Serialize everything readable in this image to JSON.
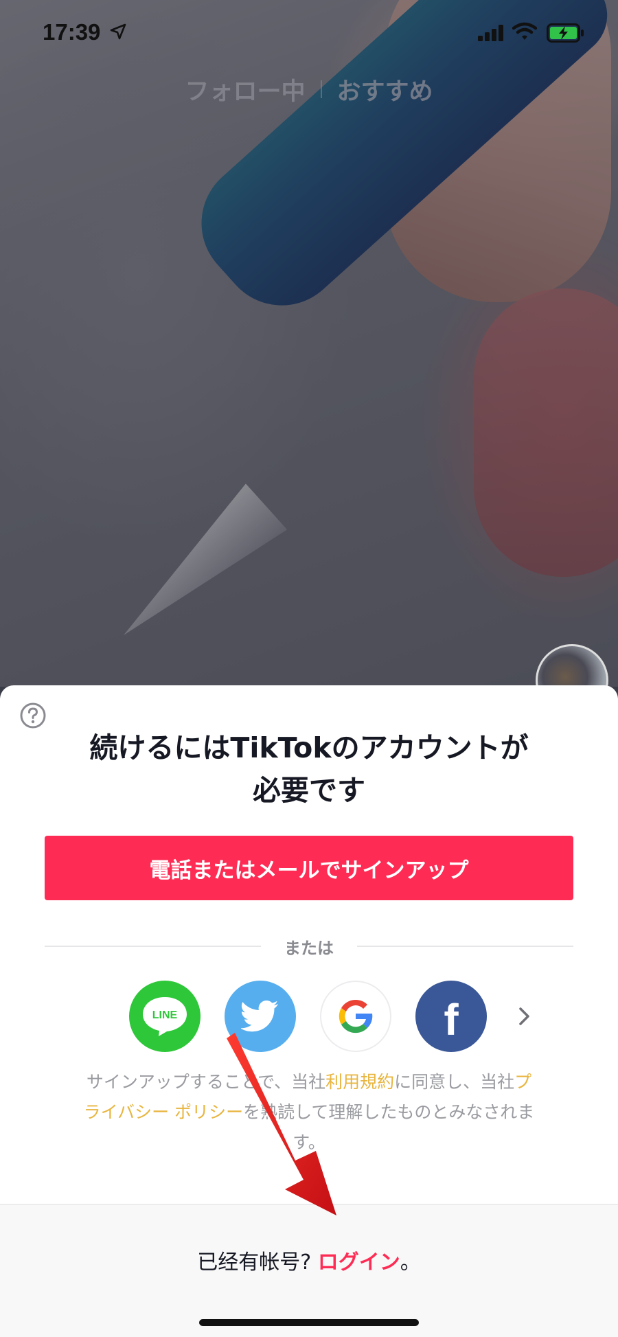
{
  "status_bar": {
    "time": "17:39"
  },
  "feed_tabs": {
    "following": "フォロー中",
    "for_you": "おすすめ"
  },
  "sheet": {
    "title": "続けるにはTikTokのアカウントが必要です",
    "signup_label": "電話またはメールでサインアップ",
    "or_label": "または",
    "social": {
      "line_label": "LINE",
      "facebook_label": "f"
    },
    "terms": {
      "part1": "サインアップすることで、当社",
      "terms_link": "利用規約",
      "part2": "に同意し、当社",
      "privacy_link": "プライバシー ポリシー",
      "part3": "を熟読して理解したものとみなされます。"
    },
    "login": {
      "prompt": "已经有帐号? ",
      "link": "ログイン",
      "suffix": "。"
    }
  },
  "colors": {
    "primary": "#fe2c55",
    "link_accent": "#e8b53f",
    "line_green": "#2ec739",
    "twitter_blue": "#56aeee",
    "facebook_blue": "#3a5797",
    "annotation_arrow": "#e3161b"
  }
}
